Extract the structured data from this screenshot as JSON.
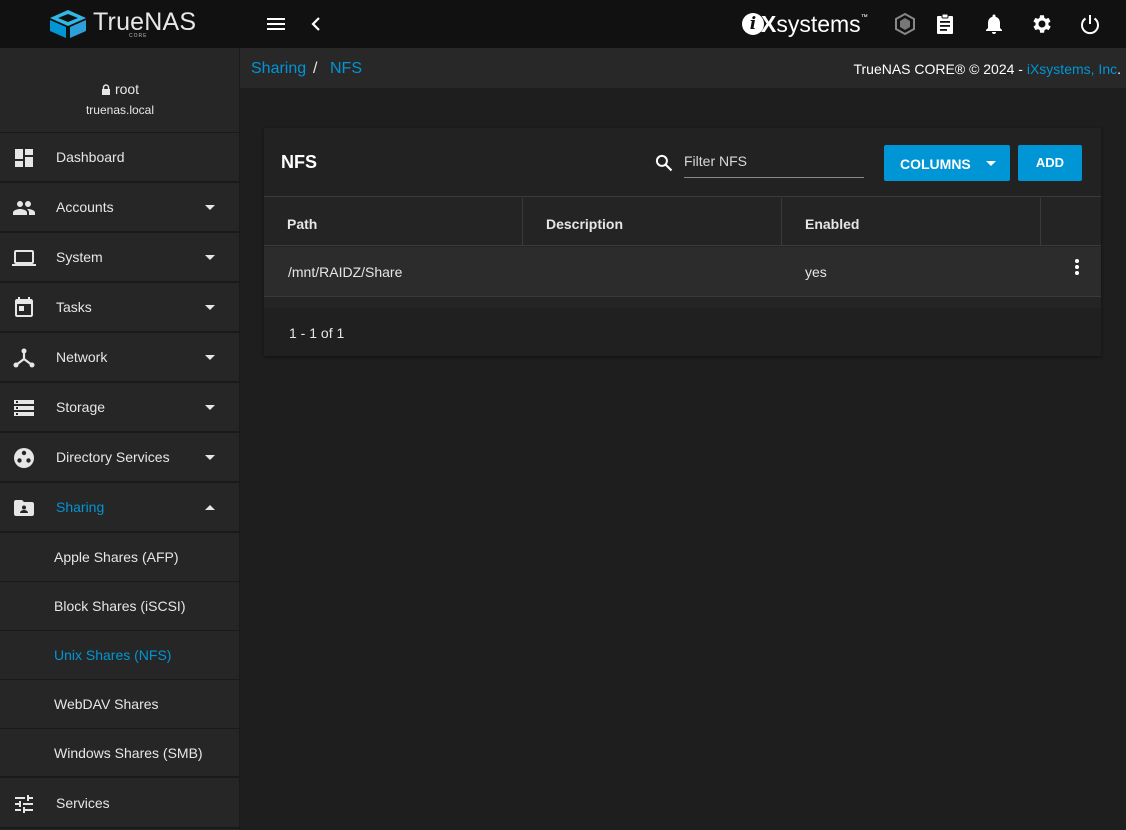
{
  "app": {
    "logo_text": "TrueNAS",
    "logo_sub": "CORE",
    "vendor_logo": "iXsystems",
    "accent_color": "#0095d5"
  },
  "topbar": {
    "icons": [
      "menu-icon",
      "back-chevron-icon",
      "truecommand-icon",
      "tasks-clipboard-icon",
      "notifications-bell-icon",
      "settings-gear-icon",
      "power-icon"
    ]
  },
  "user": {
    "name": "root",
    "host": "truenas.local"
  },
  "sidebar": {
    "items": [
      {
        "label": "Dashboard",
        "icon": "dashboard-icon"
      },
      {
        "label": "Accounts",
        "icon": "accounts-icon"
      },
      {
        "label": "System",
        "icon": "laptop-icon"
      },
      {
        "label": "Tasks",
        "icon": "calendar-icon"
      },
      {
        "label": "Network",
        "icon": "network-icon"
      },
      {
        "label": "Storage",
        "icon": "storage-icon"
      },
      {
        "label": "Directory Services",
        "icon": "directory-icon"
      },
      {
        "label": "Sharing",
        "icon": "shared-folder-icon"
      },
      {
        "label": "Services",
        "icon": "tune-icon"
      }
    ],
    "sharing_sub": [
      {
        "label": "Apple Shares (AFP)"
      },
      {
        "label": "Block Shares (iSCSI)"
      },
      {
        "label": "Unix Shares (NFS)"
      },
      {
        "label": "WebDAV Shares"
      },
      {
        "label": "Windows Shares (SMB)"
      }
    ]
  },
  "breadcrumb": {
    "parent": "Sharing",
    "separator": "/",
    "current": "NFS"
  },
  "copyright": {
    "text": "TrueNAS CORE® © 2024 - ",
    "link": "iXsystems, Inc",
    "suffix": "."
  },
  "card": {
    "title": "NFS",
    "filter_placeholder": "Filter NFS",
    "columns_label": "COLUMNS",
    "add_label": "ADD",
    "columns": [
      "Path",
      "Description",
      "Enabled"
    ],
    "rows": [
      {
        "path": "/mnt/RAIDZ/Share",
        "description": "",
        "enabled": "yes"
      }
    ],
    "pager": "1 - 1 of 1"
  }
}
